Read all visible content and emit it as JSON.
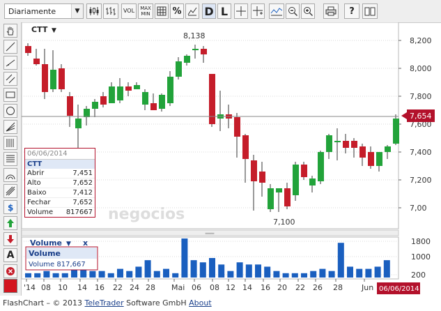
{
  "toolbar": {
    "period": "Diariamente",
    "vol_label": "VOL",
    "maxmin_label": "MAX\nMIN",
    "percent_label": "%",
    "d_label": "D",
    "l_label": "L",
    "help_label": "?"
  },
  "chart": {
    "symbol": "CTT",
    "y_ticks": [
      "8,200",
      "8,000",
      "7,800",
      "7,600",
      "7,400",
      "7,200",
      "7,00"
    ],
    "high_label": "8,138",
    "low_label": "7,100",
    "last_price": "7,654",
    "x_ticks": [
      "'14",
      "08",
      "10",
      "14",
      "16",
      "22",
      "24",
      "28",
      "Mai",
      "06",
      "08",
      "12",
      "14",
      "16",
      "20",
      "22",
      "26",
      "28",
      "Jun"
    ],
    "date_badge": "06/06/2014"
  },
  "info_box": {
    "date": "06/06/2014",
    "symbol": "CTT",
    "rows": [
      {
        "label": "Abrir",
        "value": "7,451"
      },
      {
        "label": "Alto",
        "value": "7,652"
      },
      {
        "label": "Baixo",
        "value": "7,412"
      },
      {
        "label": "Fechar",
        "value": "7,652"
      },
      {
        "label": "Volume",
        "value": "817667"
      }
    ]
  },
  "watermark": "negocios",
  "volume_panel": {
    "title": "Volume",
    "close": "x",
    "label_title": "Volume",
    "label_value": "Volume  817,667",
    "y_ticks": [
      "1800",
      "1000",
      "200"
    ],
    "values": [
      2,
      2,
      3,
      2,
      2,
      5,
      4,
      3,
      3,
      2,
      4,
      3,
      5,
      8,
      3,
      4,
      2,
      18,
      8,
      7,
      9,
      6,
      3,
      7,
      6,
      6,
      5,
      3,
      2,
      2,
      2,
      3,
      4,
      3,
      16,
      5,
      4,
      4,
      5,
      8
    ]
  },
  "colors": {
    "up": "#22a33a",
    "down": "#c51d2a",
    "volume": "#1a5fbf",
    "grid": "#d8d8d8",
    "badge": "#b3112b"
  },
  "footer": {
    "prefix": "FlashChart – © 2013 ",
    "company_link": "TeleTrader",
    "middle": " Software GmbH ",
    "about_link": "About"
  }
}
